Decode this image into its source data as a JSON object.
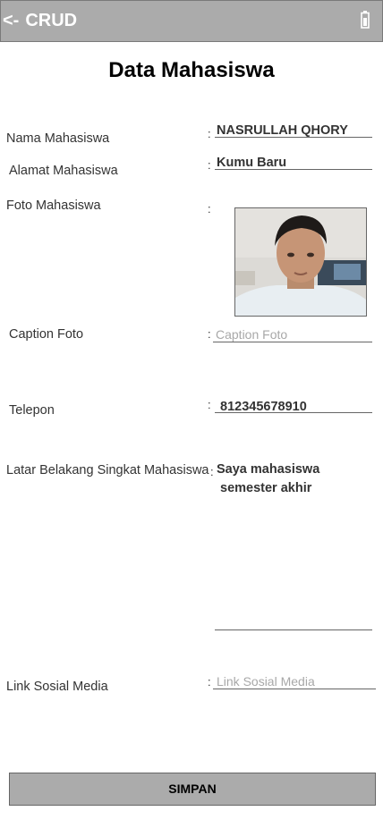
{
  "appbar": {
    "back_arrow": "<-",
    "title": "CRUD",
    "status_icon": "battery-icon"
  },
  "page_title": "Data Mahasiswa",
  "form": {
    "colon": ":",
    "nama": {
      "label": "Nama Mahasiswa",
      "value": "NASRULLAH QHORY"
    },
    "alamat": {
      "label": "Alamat Mahasiswa",
      "value": "Kumu Baru"
    },
    "foto": {
      "label": "Foto Mahasiswa"
    },
    "caption": {
      "label": "Caption Foto",
      "placeholder": "Caption Foto",
      "value": ""
    },
    "telepon": {
      "label": "Telepon",
      "value": "812345678910"
    },
    "latar": {
      "label": "Latar Belakang Singkat Mahasiswa",
      "line1": "Saya mahasiswa",
      "line2": "semester akhir"
    },
    "link": {
      "label": "Link Sosial Media",
      "placeholder": "Link Sosial Media",
      "value": ""
    }
  },
  "save_button": "SIMPAN"
}
